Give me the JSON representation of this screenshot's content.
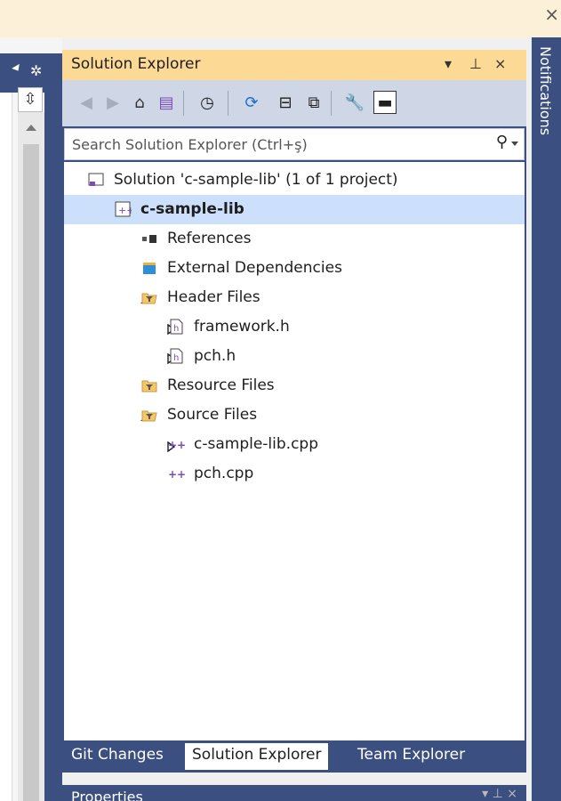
{
  "window": {
    "close_glyph": "×"
  },
  "left_edge": {
    "split_glyph": "⇳"
  },
  "panel": {
    "title": "Solution Explorer",
    "dropdown_glyph": "▾",
    "pin_glyph": "⊥",
    "close_glyph": "×"
  },
  "toolbar": {
    "items": [
      {
        "name": "back-icon",
        "glyph": "◀",
        "enabled": false
      },
      {
        "name": "forward-icon",
        "glyph": "▶",
        "enabled": false
      },
      {
        "name": "home-icon",
        "glyph": "⌂",
        "enabled": true
      },
      {
        "name": "switch-views-icon",
        "glyph": "▤",
        "enabled": true
      },
      {
        "name": "pending-changes-filter-icon",
        "glyph": "◷",
        "enabled": true
      },
      {
        "name": "sync-icon",
        "glyph": "⟳",
        "enabled": true
      },
      {
        "name": "collapse-all-icon",
        "glyph": "⊟",
        "enabled": true
      },
      {
        "name": "show-all-files-icon",
        "glyph": "⧉",
        "enabled": true
      },
      {
        "name": "properties-icon",
        "glyph": "🔧",
        "enabled": true
      },
      {
        "name": "preview-icon",
        "glyph": "▬",
        "enabled": true
      }
    ]
  },
  "search": {
    "placeholder": "Search Solution Explorer (Ctrl+ş)"
  },
  "tree": [
    {
      "label": "Solution 'c-sample-lib' (1 of 1 project)",
      "icon": "solution-icon",
      "expander": "none",
      "selected": false,
      "bold": false
    },
    {
      "label": "c-sample-lib",
      "icon": "cpp-project-icon",
      "expander": "expanded",
      "selected": true,
      "bold": true
    },
    {
      "label": "References",
      "icon": "references-icon",
      "expander": "none",
      "selected": false,
      "bold": false
    },
    {
      "label": "External Dependencies",
      "icon": "external-dependencies-icon",
      "expander": "none",
      "selected": false,
      "bold": false
    },
    {
      "label": "Header Files",
      "icon": "filter-folder-open-icon",
      "expander": "expanded",
      "selected": false,
      "bold": false
    },
    {
      "label": "framework.h",
      "icon": "header-file-icon",
      "expander": "collapsed",
      "selected": false,
      "bold": false
    },
    {
      "label": "pch.h",
      "icon": "header-file-icon",
      "expander": "collapsed",
      "selected": false,
      "bold": false
    },
    {
      "label": "Resource Files",
      "icon": "filter-folder-icon",
      "expander": "none",
      "selected": false,
      "bold": false
    },
    {
      "label": "Source Files",
      "icon": "filter-folder-open-icon",
      "expander": "expanded",
      "selected": false,
      "bold": false
    },
    {
      "label": "c-sample-lib.cpp",
      "icon": "cpp-file-icon",
      "expander": "collapsed",
      "selected": false,
      "bold": false
    },
    {
      "label": "pch.cpp",
      "icon": "cpp-file-icon",
      "expander": "none",
      "selected": false,
      "bold": false
    }
  ],
  "tabs": [
    {
      "label": "Git Changes",
      "active": false
    },
    {
      "label": "Solution Explorer",
      "active": true
    },
    {
      "label": "Team Explorer",
      "active": false
    }
  ],
  "properties": {
    "title": "Properties"
  },
  "notifications": {
    "label": "Notifications"
  },
  "colors": {
    "title_bar": "#fcd995",
    "panel_frame": "#3b4f81",
    "toolbar": "#cfd6e5",
    "selection": "#cce0fb"
  }
}
